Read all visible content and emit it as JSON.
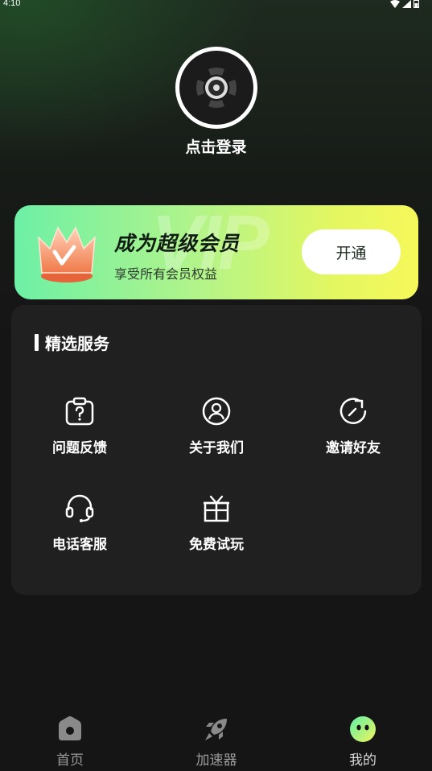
{
  "status_bar": {
    "time": "4:10",
    "icons": [
      "wifi-icon",
      "signal-icon",
      "battery-icon"
    ]
  },
  "profile": {
    "avatar_icon": "speaker-avatar-icon",
    "login_label": "点击登录"
  },
  "vip_banner": {
    "watermark": "VIP",
    "title": "成为超级会员",
    "subtitle": "享受所有会员权益",
    "button_label": "开通",
    "colors": {
      "start": "#6df0a6",
      "end": "#f6f85a"
    }
  },
  "services": {
    "heading": "精选服务",
    "items": [
      {
        "label": "问题反馈",
        "icon": "feedback-clipboard-icon"
      },
      {
        "label": "关于我们",
        "icon": "about-person-icon"
      },
      {
        "label": "邀请好友",
        "icon": "invite-share-icon"
      },
      {
        "label": "电话客服",
        "icon": "headset-icon"
      },
      {
        "label": "免费试玩",
        "icon": "gift-icon"
      }
    ]
  },
  "tab_bar": {
    "tabs": [
      {
        "label": "首页",
        "icon": "home-icon",
        "active": false
      },
      {
        "label": "加速器",
        "icon": "rocket-icon",
        "active": false
      },
      {
        "label": "我的",
        "icon": "smiley-icon",
        "active": true
      }
    ]
  }
}
